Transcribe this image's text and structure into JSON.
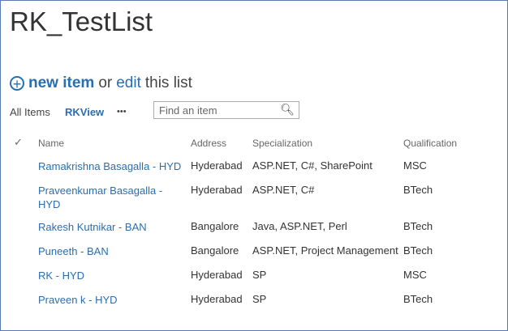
{
  "title": "RK_TestList",
  "command": {
    "new_item": "new item",
    "or": "or",
    "edit": "edit",
    "this_list": "this list"
  },
  "views": {
    "all_items": "All Items",
    "rkview": "RKView",
    "more": "•••"
  },
  "search": {
    "placeholder": "Find an item"
  },
  "columns": [
    "Name",
    "Address",
    "Specialization",
    "Qualification"
  ],
  "rows": [
    {
      "name": "Ramakrishna Basagalla - HYD",
      "address": "Hyderabad",
      "spec": "ASP.NET, C#, SharePoint",
      "qual": "MSC"
    },
    {
      "name": "Praveenkumar Basagalla -",
      "name2": "HYD",
      "address": "Hyderabad",
      "spec": "ASP.NET, C#",
      "qual": "BTech"
    },
    {
      "name": "Rakesh Kutnikar - BAN",
      "address": "Bangalore",
      "spec": "Java, ASP.NET, Perl",
      "qual": "BTech"
    },
    {
      "name": "Puneeth - BAN",
      "address": "Bangalore",
      "spec": "ASP.NET, Project Management",
      "qual": "BTech"
    },
    {
      "name": "RK - HYD",
      "address": "Hyderabad",
      "spec": "SP",
      "qual": "MSC"
    },
    {
      "name": "Praveen k - HYD",
      "address": "Hyderabad",
      "spec": "SP",
      "qual": "BTech"
    }
  ]
}
